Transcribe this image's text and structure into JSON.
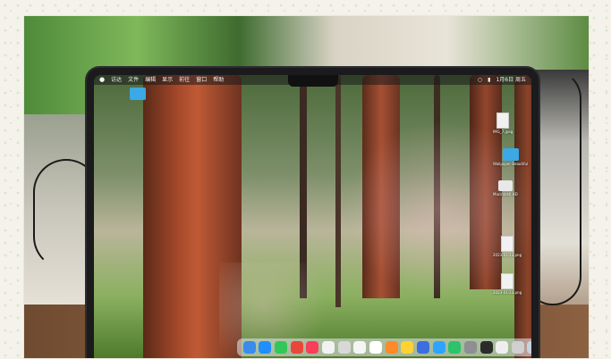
{
  "menubar": {
    "apple_icon": "apple-icon",
    "items": [
      "访达",
      "文件",
      "编辑",
      "显示",
      "前往",
      "窗口",
      "帮助"
    ],
    "clock": "1月6日 周五"
  },
  "desktop_icons": [
    {
      "name": "folder",
      "label": ""
    },
    {
      "name": "image-file",
      "label": "IMG_7.jpeg"
    },
    {
      "name": "folder",
      "label": "Wallpaper Beautiful"
    },
    {
      "name": "drive",
      "label": "Macintosh HD"
    },
    {
      "name": "image-file",
      "label": "2023-01-23.png"
    },
    {
      "name": "image-file",
      "label": "2023-01-23.png"
    }
  ],
  "dock_items": [
    {
      "name": "finder-icon",
      "color": "#3a8bea"
    },
    {
      "name": "app-store-icon",
      "color": "#1f8fff"
    },
    {
      "name": "messages-icon",
      "color": "#33c759"
    },
    {
      "name": "chrome-icon",
      "color": "#e9473b"
    },
    {
      "name": "music-icon",
      "color": "#fa3d5a"
    },
    {
      "name": "notion-icon",
      "color": "#f2f2f2"
    },
    {
      "name": "preview-icon",
      "color": "#d8d8d8"
    },
    {
      "name": "photos-icon",
      "color": "#f5f5f5"
    },
    {
      "name": "calendar-icon",
      "color": "#ffffff"
    },
    {
      "name": "reminders-icon",
      "color": "#ff8a2a"
    },
    {
      "name": "notes-icon",
      "color": "#ffd233"
    },
    {
      "name": "sketch-icon",
      "color": "#3d6de0"
    },
    {
      "name": "safari-icon",
      "color": "#2fa4ff"
    },
    {
      "name": "wechat-icon",
      "color": "#2dc26b"
    },
    {
      "name": "system-settings-icon",
      "color": "#8e8e93"
    },
    {
      "name": "terminal-icon",
      "color": "#2b2b2b"
    },
    {
      "name": "files-icon",
      "color": "#eeeeee"
    },
    {
      "name": "activity-monitor-icon",
      "color": "#cfcfcf"
    },
    {
      "name": "downloads-icon",
      "color": "#c8d2de"
    },
    {
      "name": "trash-icon",
      "color": "#b8bcc2"
    }
  ]
}
